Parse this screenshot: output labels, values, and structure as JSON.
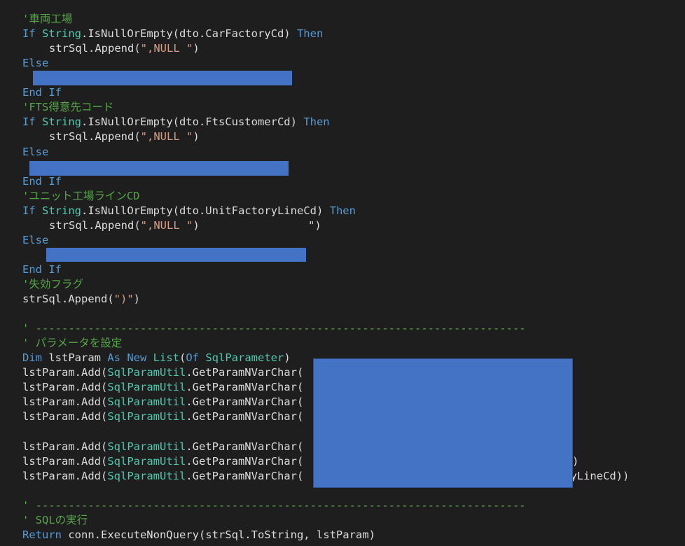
{
  "colors": {
    "background": "#1e1e1e",
    "keyword": "#569cd6",
    "comment": "#57a64a",
    "type": "#4ec9b0",
    "string": "#d69d85",
    "plain": "#dcdcdc",
    "redaction": "#4472c4"
  },
  "lines": [
    {
      "indent": 0,
      "tokens": [
        {
          "t": "c",
          "v": "'車両工場"
        }
      ]
    },
    {
      "indent": 0,
      "tokens": [
        {
          "t": "k",
          "v": "If "
        },
        {
          "t": "y",
          "v": "String"
        },
        {
          "t": "p",
          "v": ".IsNullOrEmpty(dto.CarFactoryCd) "
        },
        {
          "t": "k",
          "v": "Then"
        }
      ]
    },
    {
      "indent": 1,
      "tokens": [
        {
          "t": "p",
          "v": "strSql.Append("
        },
        {
          "t": "s",
          "v": "\",NULL \""
        },
        {
          "t": "p",
          "v": ")"
        }
      ]
    },
    {
      "indent": 0,
      "tokens": [
        {
          "t": "k",
          "v": "Else"
        }
      ]
    },
    {
      "indent": 0,
      "tokens": []
    },
    {
      "indent": 0,
      "tokens": [
        {
          "t": "k",
          "v": "End If"
        }
      ]
    },
    {
      "indent": 0,
      "tokens": [
        {
          "t": "c",
          "v": "'FTS得意先コード"
        }
      ]
    },
    {
      "indent": 0,
      "tokens": [
        {
          "t": "k",
          "v": "If "
        },
        {
          "t": "y",
          "v": "String"
        },
        {
          "t": "p",
          "v": ".IsNullOrEmpty(dto.FtsCustomerCd) "
        },
        {
          "t": "k",
          "v": "Then"
        }
      ]
    },
    {
      "indent": 1,
      "tokens": [
        {
          "t": "p",
          "v": "strSql.Append("
        },
        {
          "t": "s",
          "v": "\",NULL \""
        },
        {
          "t": "p",
          "v": ")"
        }
      ]
    },
    {
      "indent": 0,
      "tokens": [
        {
          "t": "k",
          "v": "Else"
        }
      ]
    },
    {
      "indent": 0,
      "tokens": []
    },
    {
      "indent": 0,
      "tokens": [
        {
          "t": "k",
          "v": "End If"
        }
      ]
    },
    {
      "indent": 0,
      "tokens": [
        {
          "t": "c",
          "v": "'ユニット工場ラインCD"
        }
      ]
    },
    {
      "indent": 0,
      "tokens": [
        {
          "t": "k",
          "v": "If "
        },
        {
          "t": "y",
          "v": "String"
        },
        {
          "t": "p",
          "v": ".IsNullOrEmpty(dto.UnitFactoryLineCd) "
        },
        {
          "t": "k",
          "v": "Then"
        }
      ]
    },
    {
      "indent": 1,
      "tokens": [
        {
          "t": "p",
          "v": "strSql.Append("
        },
        {
          "t": "s",
          "v": "\",NULL \""
        },
        {
          "t": "p",
          "v": ")"
        }
      ]
    },
    {
      "indent": 0,
      "tokens": [
        {
          "t": "k",
          "v": "Else"
        }
      ]
    },
    {
      "indent": 0,
      "tokens": []
    },
    {
      "indent": 0,
      "tokens": [
        {
          "t": "k",
          "v": "End If"
        }
      ]
    },
    {
      "indent": 0,
      "tokens": [
        {
          "t": "c",
          "v": "'失効フラグ"
        }
      ]
    },
    {
      "indent": 0,
      "tokens": [
        {
          "t": "p",
          "v": "strSql.Append("
        },
        {
          "t": "s",
          "v": "\")\""
        },
        {
          "t": "p",
          "v": ")"
        }
      ]
    },
    {
      "indent": 0,
      "tokens": []
    },
    {
      "indent": 0,
      "tokens": [
        {
          "t": "c",
          "v": "' ---------------------------------------------------------------------------"
        }
      ]
    },
    {
      "indent": 0,
      "tokens": [
        {
          "t": "c",
          "v": "' パラメータを設定"
        }
      ]
    },
    {
      "indent": 0,
      "tokens": [
        {
          "t": "k",
          "v": "Dim "
        },
        {
          "t": "p",
          "v": "lstParam "
        },
        {
          "t": "k",
          "v": "As New "
        },
        {
          "t": "y",
          "v": "List"
        },
        {
          "t": "p",
          "v": "("
        },
        {
          "t": "k",
          "v": "Of "
        },
        {
          "t": "y",
          "v": "SqlParameter"
        },
        {
          "t": "p",
          "v": ")"
        }
      ]
    },
    {
      "indent": 0,
      "tokens": [
        {
          "t": "p",
          "v": "lstParam.Add("
        },
        {
          "t": "y",
          "v": "SqlParamUtil"
        },
        {
          "t": "p",
          "v": ".GetParamNVarChar("
        }
      ]
    },
    {
      "indent": 0,
      "tokens": [
        {
          "t": "p",
          "v": "lstParam.Add("
        },
        {
          "t": "y",
          "v": "SqlParamUtil"
        },
        {
          "t": "p",
          "v": ".GetParamNVarChar("
        }
      ]
    },
    {
      "indent": 0,
      "tokens": [
        {
          "t": "p",
          "v": "lstParam.Add("
        },
        {
          "t": "y",
          "v": "SqlParamUtil"
        },
        {
          "t": "p",
          "v": ".GetParamNVarChar("
        }
      ]
    },
    {
      "indent": 0,
      "tokens": [
        {
          "t": "p",
          "v": "lstParam.Add("
        },
        {
          "t": "y",
          "v": "SqlParamUtil"
        },
        {
          "t": "p",
          "v": ".GetParamNVarChar("
        }
      ]
    },
    {
      "indent": 0,
      "tokens": []
    },
    {
      "indent": 0,
      "tokens": [
        {
          "t": "p",
          "v": "lstParam.Add("
        },
        {
          "t": "y",
          "v": "SqlParamUtil"
        },
        {
          "t": "p",
          "v": ".GetParamNVarChar("
        }
      ]
    },
    {
      "indent": 0,
      "tokens": [
        {
          "t": "p",
          "v": "lstParam.Add("
        },
        {
          "t": "y",
          "v": "SqlParamUtil"
        },
        {
          "t": "p",
          "v": ".GetParamNVarChar("
        }
      ]
    },
    {
      "indent": 0,
      "tokens": [
        {
          "t": "p",
          "v": "lstParam.Add("
        },
        {
          "t": "y",
          "v": "SqlParamUtil"
        },
        {
          "t": "p",
          "v": ".GetParamNVarChar("
        }
      ]
    },
    {
      "indent": 0,
      "tokens": []
    },
    {
      "indent": 0,
      "tokens": [
        {
          "t": "c",
          "v": "' ---------------------------------------------------------------------------"
        }
      ]
    },
    {
      "indent": 0,
      "tokens": [
        {
          "t": "c",
          "v": "' SQLの実行"
        }
      ]
    },
    {
      "indent": 0,
      "tokens": [
        {
          "t": "k",
          "v": "Return "
        },
        {
          "t": "p",
          "v": "conn.ExecuteNonQuery(strSql.ToString, lstParam)"
        }
      ]
    }
  ],
  "overflow_fragments": [
    {
      "line": 14,
      "text": "\")"
    },
    {
      "line": 30,
      "text": ")"
    },
    {
      "line": 31,
      "text": "ryLineCd))"
    }
  ]
}
